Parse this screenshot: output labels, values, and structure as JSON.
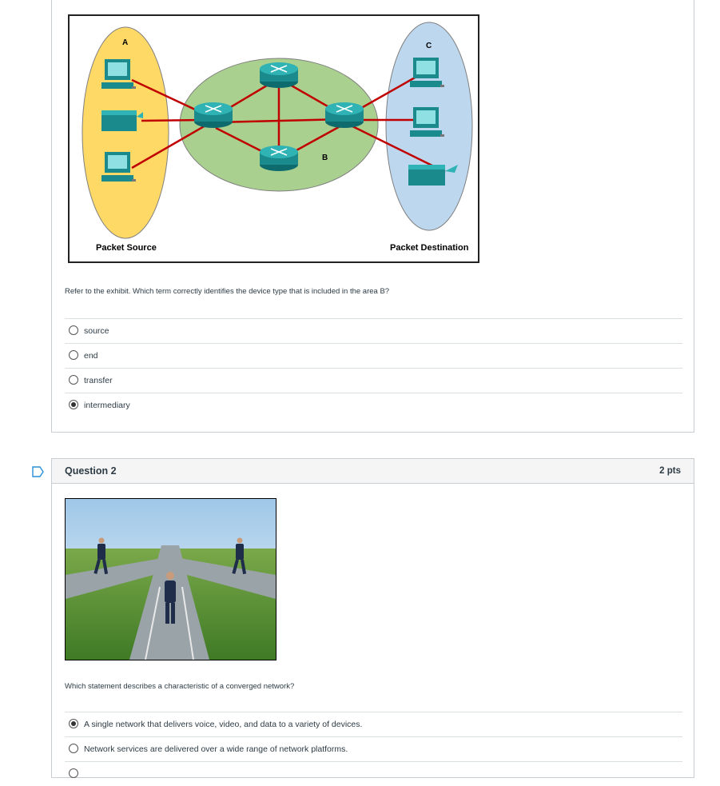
{
  "question1": {
    "exhibit": {
      "label_a": "A",
      "label_b": "B",
      "label_c": "C",
      "caption_left": "Packet Source",
      "caption_right": "Packet Destination"
    },
    "text": "Refer to the exhibit. Which term correctly identifies the device type that is included in the area B?",
    "answers": [
      {
        "label": "source",
        "selected": false
      },
      {
        "label": "end",
        "selected": false
      },
      {
        "label": "transfer",
        "selected": false
      },
      {
        "label": "intermediary",
        "selected": true
      }
    ]
  },
  "question2": {
    "title": "Question 2",
    "points": "2 pts",
    "image": "converging-roads-businessmen-photo",
    "text": "Which statement describes a characteristic of a converged network?",
    "answers": [
      {
        "label": "A single network that delivers voice, video, and data to a variety of devices.",
        "selected": true
      },
      {
        "label": "Network services are delivered over a wide range of network platforms.",
        "selected": false
      }
    ]
  },
  "icons": {
    "flag": "bookmark-flag-icon",
    "router": "router-icon",
    "pc": "desktop-pc-icon",
    "printer": "printer-icon"
  },
  "colors": {
    "source_area": "#ffd966",
    "intermediary_area": "#a9d08e",
    "destination_area": "#bdd7ee",
    "link": "#c00000",
    "router": "#1a8a8c",
    "flag": "#2a8fd6"
  }
}
